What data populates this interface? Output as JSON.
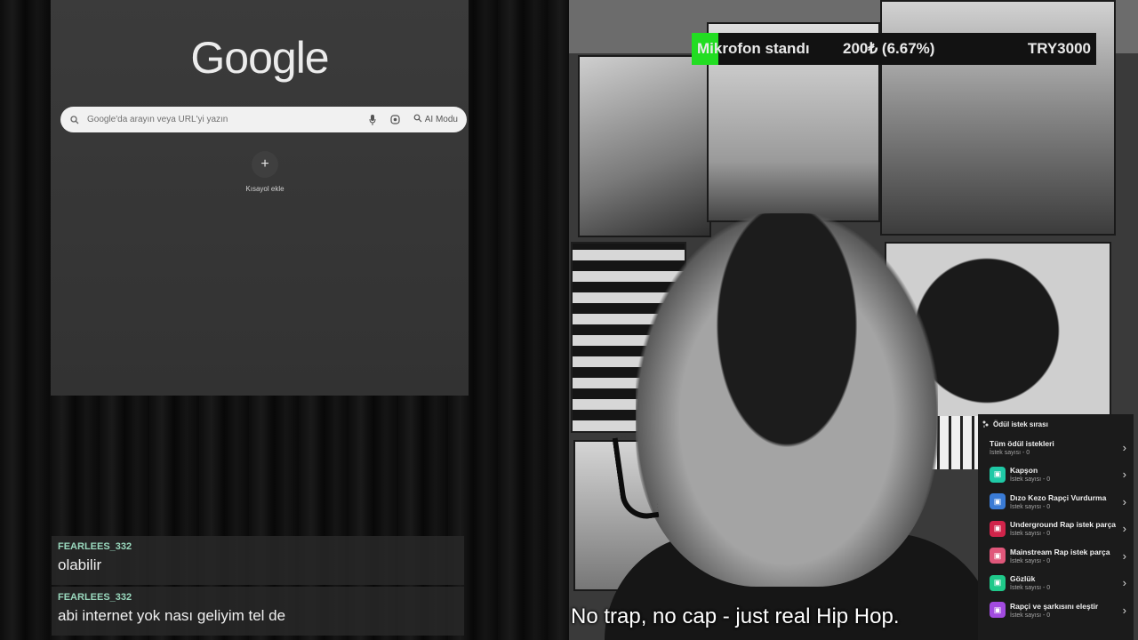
{
  "browser": {
    "logo": "Google",
    "search": {
      "placeholder": "Google'da arayın veya URL'yi yazın",
      "ai_mode_label": "AI Modu"
    },
    "shortcut": {
      "symbol": "+",
      "label": "Kısayol ekle"
    }
  },
  "ticker": {
    "item": "Mikrofon standı",
    "amount": "200₺ (6.67%)",
    "goal": "TRY3000",
    "progress_percent": 6.67,
    "fill_color": "#22dd22"
  },
  "chat": {
    "messages": [
      {
        "user": "FEARLEES_332",
        "text": "olabilir"
      },
      {
        "user": "FEARLEES_332",
        "text": "abi internet yok nası geliyim tel de"
      }
    ]
  },
  "subtitle": "No trap, no cap - just real Hip Hop.",
  "rewards": {
    "header": "Ödül istek sırası",
    "all": {
      "title": "Tüm ödül istekleri",
      "count": "İstek sayısı - 0"
    },
    "items": [
      {
        "title": "Kapşon",
        "count": "İstek sayısı - 0",
        "color": "#1fc9a6"
      },
      {
        "title": "Dızo Kezo Rapçi Vurdurma",
        "count": "İstek sayısı - 0",
        "color": "#3a7bd5"
      },
      {
        "title": "Underground Rap istek parça",
        "count": "İstek sayısı - 0",
        "color": "#d0244a"
      },
      {
        "title": "Mainstream Rap istek parça",
        "count": "İstek sayısı - 0",
        "color": "#e0577a"
      },
      {
        "title": "Gözlük",
        "count": "İstek sayısı - 0",
        "color": "#1fc98a"
      },
      {
        "title": "Rapçi ve şarkısını eleştir",
        "count": "İstek sayısı - 0",
        "color": "#a24be0"
      }
    ]
  }
}
